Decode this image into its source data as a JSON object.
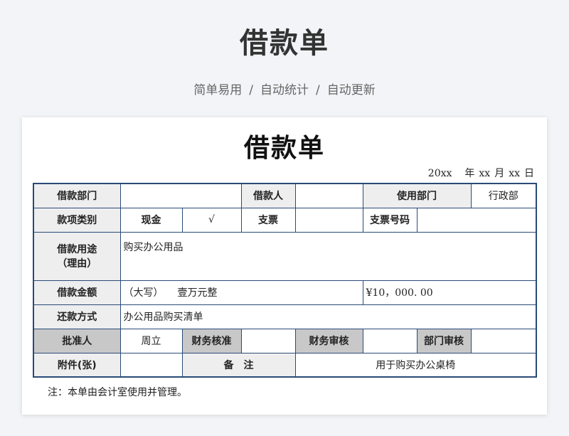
{
  "header": {
    "title": "借款单",
    "tags": [
      "简单易用",
      "自动统计",
      "自动更新"
    ],
    "separator": "/"
  },
  "form": {
    "title": "借款单",
    "date": {
      "year": "20xx",
      "year_unit": "年",
      "month": "xx",
      "month_unit": "月",
      "day": "xx",
      "day_unit": "日"
    },
    "row1": {
      "dept_label": "借款部门",
      "dept_value": "",
      "borrower_label": "借款人",
      "borrower_value": "",
      "use_dept_label": "使用部门",
      "use_dept_value": "行政部"
    },
    "row2": {
      "type_label": "款项类别",
      "cash_label": "现金",
      "cash_check": "√",
      "check_label": "支票",
      "check_value": "",
      "check_no_label": "支票号码",
      "check_no_value": ""
    },
    "row3": {
      "purpose_label_1": "借款用途",
      "purpose_label_2": "（理由）",
      "purpose_value": "购买办公用品"
    },
    "row4": {
      "amount_label": "借款金额",
      "caps_label": "（大写）",
      "caps_value": "壹万元整",
      "amount_value": "¥10，000. 00"
    },
    "row5": {
      "repay_label": "还款方式",
      "repay_value": "办公用品购买清单"
    },
    "row6": {
      "approver_label": "批准人",
      "approver_value": "周立",
      "finance_approve_label": "财务核准",
      "finance_approve_value": "",
      "finance_review_label": "财务审核",
      "finance_review_value": "",
      "dept_review_label": "部门审核",
      "dept_review_value": ""
    },
    "row7": {
      "attach_label": "附件(张)",
      "attach_value": "",
      "remark_label": "备　注",
      "remark_value": "用于购买办公桌椅"
    },
    "note": "注：本单由会计室使用并管理。"
  }
}
